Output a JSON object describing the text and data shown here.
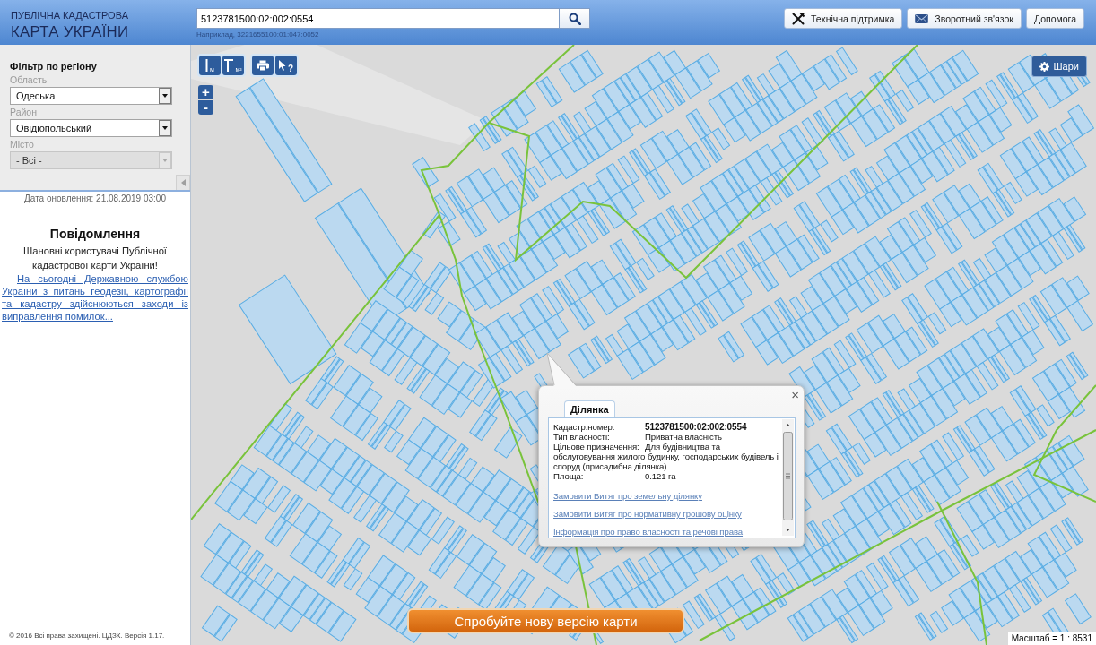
{
  "header": {
    "logo": {
      "line_1": "ПУБЛІЧНА КАДАСТРОВА",
      "line_2": "КАРТА УКРАЇНИ"
    },
    "search": {
      "value": "5123781500:02:002:0554",
      "hint": "Наприклад, 3221655100:01:047:0052"
    },
    "buttons": [
      {
        "kind": "support",
        "label": "Технічна підтримка"
      },
      {
        "kind": "feedback",
        "label": "Зворотний зв'язок"
      },
      {
        "kind": "help",
        "label": "Допомога"
      }
    ]
  },
  "sidebar": {
    "filter": {
      "title": "Фільтр по регіону",
      "fields": [
        {
          "label": "Область",
          "value": "Одеська",
          "disabled": false
        },
        {
          "label": "Район",
          "value": "Овідіопольський",
          "disabled": false
        },
        {
          "label": "Місто",
          "value": "- Всі -",
          "disabled": true
        }
      ]
    },
    "update_date": "Дата оновлення: 21.08.2019 03:00",
    "notice": {
      "title": "Повідомлення",
      "text": "Шановні користувачі Публічної кадастрової карти України!",
      "link": "На сьогодні Державною службою України з питань геодезії, картографії та кадастру здійснюються заходи із виправлення помилок..."
    },
    "footer": "© 2016 Всі права захищені. ЦДЗК. Версія 1.17."
  },
  "map": {
    "tool_groups": [
      {
        "tools": [
          {
            "kind": "measure_length",
            "label": "м"
          },
          {
            "kind": "measure_area",
            "label": "м²"
          }
        ]
      },
      {
        "tools": [
          {
            "kind": "print"
          },
          {
            "kind": "identify",
            "label": "?"
          }
        ]
      }
    ],
    "zoom": [
      {
        "kind": "in",
        "label": "+"
      },
      {
        "kind": "out",
        "label": "-"
      }
    ],
    "layers_button": "Шари",
    "popup": {
      "close": "×",
      "tabs": [
        {
          "label": "Ділянка",
          "selected": true
        }
      ],
      "rows": [
        {
          "kind": "key",
          "label": "Кадастр.номер:",
          "value": "5123781500:02:002:0554"
        },
        {
          "kind": "plain",
          "label": "Тип власності:",
          "value": "Приватна власність"
        },
        {
          "kind": "plain",
          "label": "Цільове призначення:",
          "value": "Для будівництва та обслуговування жилого будинку, господарських будівель і споруд (присадибна ділянка)"
        },
        {
          "kind": "plain",
          "label": "Площа:",
          "value": "0.121 га"
        }
      ],
      "links": [
        "Замовити Витяг про земельну ділянку",
        "Замовити Витяг про нормативну грошову оцінку",
        "Інформація про право власності та речові права"
      ]
    },
    "new_version_button": "Спробуйте нову версію карти",
    "scale": "Масштаб = 1 : 8531"
  }
}
